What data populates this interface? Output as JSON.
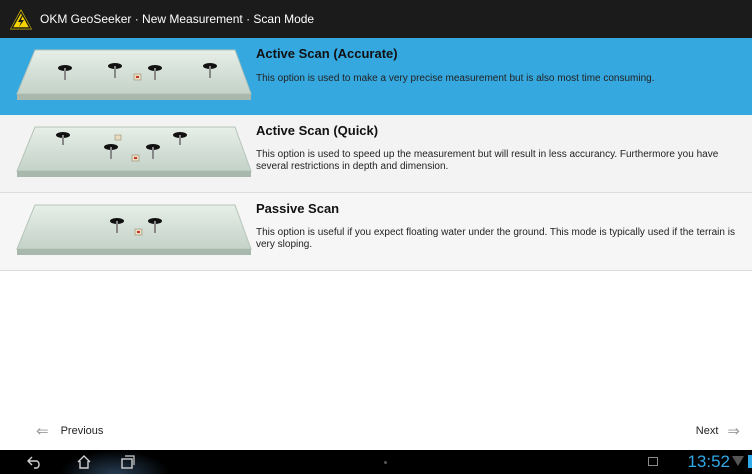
{
  "app": {
    "title": "OKM GeoSeeker · New Measurement · Scan Mode",
    "accent_color": "#35a8e0",
    "icon": "warning-triangle-logo-icon"
  },
  "options": [
    {
      "heading": "Active Scan (Accurate)",
      "description": "This option is used to make a very precise measurement but is also most time consuming.",
      "selected": true,
      "thumbnail": "field-with-four-sensors"
    },
    {
      "heading": "Active Scan (Quick)",
      "description": "This option is used to speed up the measurement but will result in less accurancy. Furthermore you have several restrictions in depth and dimension.",
      "selected": false,
      "thumbnail": "field-with-four-sensors-and-markers"
    },
    {
      "heading": "Passive Scan",
      "description": "This option is useful if you expect floating water under the ground. This mode is typically used if the terrain is very sloping.",
      "selected": false,
      "thumbnail": "field-with-two-sensors"
    }
  ],
  "nav": {
    "previous_label": "Previous",
    "next_label": "Next",
    "previous_icon": "arrow-left-icon",
    "next_icon": "arrow-right-icon"
  },
  "system_bar": {
    "time": "13:52",
    "clock_color": "#2fa9e8",
    "icons": [
      "back-icon",
      "home-icon",
      "recent-apps-icon",
      "screenshot-icon",
      "wifi-icon",
      "battery-icon"
    ]
  }
}
